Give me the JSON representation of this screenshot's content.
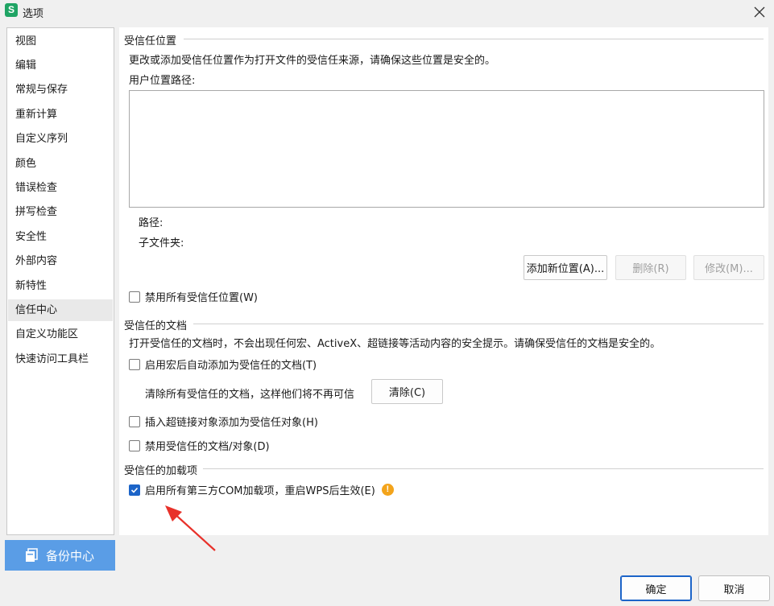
{
  "window": {
    "title": "选项",
    "app_icon_letter": "S"
  },
  "sidebar": {
    "items": [
      {
        "label": "视图"
      },
      {
        "label": "编辑"
      },
      {
        "label": "常规与保存"
      },
      {
        "label": "重新计算"
      },
      {
        "label": "自定义序列"
      },
      {
        "label": "颜色"
      },
      {
        "label": "错误检查"
      },
      {
        "label": "拼写检查"
      },
      {
        "label": "安全性"
      },
      {
        "label": "外部内容"
      },
      {
        "label": "新特性"
      },
      {
        "label": "信任中心"
      },
      {
        "label": "自定义功能区"
      },
      {
        "label": "快速访问工具栏"
      }
    ],
    "active": "信任中心",
    "backup_label": "备份中心"
  },
  "trusted_locations": {
    "title": "受信任位置",
    "description": "更改或添加受信任位置作为打开文件的受信任来源，请确保这些位置是安全的。",
    "user_paths_label": "用户位置路径:",
    "path_label": "路径:",
    "subfolder_label": "子文件夹:",
    "add_button": "添加新位置(A)...",
    "delete_button": "删除(R)",
    "modify_button": "修改(M)...",
    "disable_all_checkbox": "禁用所有受信任位置(W)",
    "disable_all_checked": false
  },
  "trusted_documents": {
    "title": "受信任的文档",
    "description": "打开受信任的文档时，不会出现任何宏、ActiveX、超链接等活动内容的安全提示。请确保受信任的文档是安全的。",
    "auto_add_checkbox": "启用宏后自动添加为受信任的文档(T)",
    "auto_add_checked": false,
    "clear_text": "清除所有受信任的文档，这样他们将不再可信",
    "clear_button": "清除(C)",
    "hyperlink_checkbox": "插入超链接对象添加为受信任对象(H)",
    "hyperlink_checked": false,
    "disable_checkbox": "禁用受信任的文档/对象(D)",
    "disable_checked": false
  },
  "trusted_addins": {
    "title": "受信任的加载项",
    "com_checkbox": "启用所有第三方COM加载项，重启WPS后生效(E)",
    "com_checked": true,
    "warning_glyph": "!"
  },
  "footer": {
    "ok": "确定",
    "cancel": "取消"
  },
  "colors": {
    "accent": "#1c64c8",
    "backup_bg": "#5a9de6",
    "warning": "#f3a41b",
    "annotation_arrow": "#e8312a"
  }
}
